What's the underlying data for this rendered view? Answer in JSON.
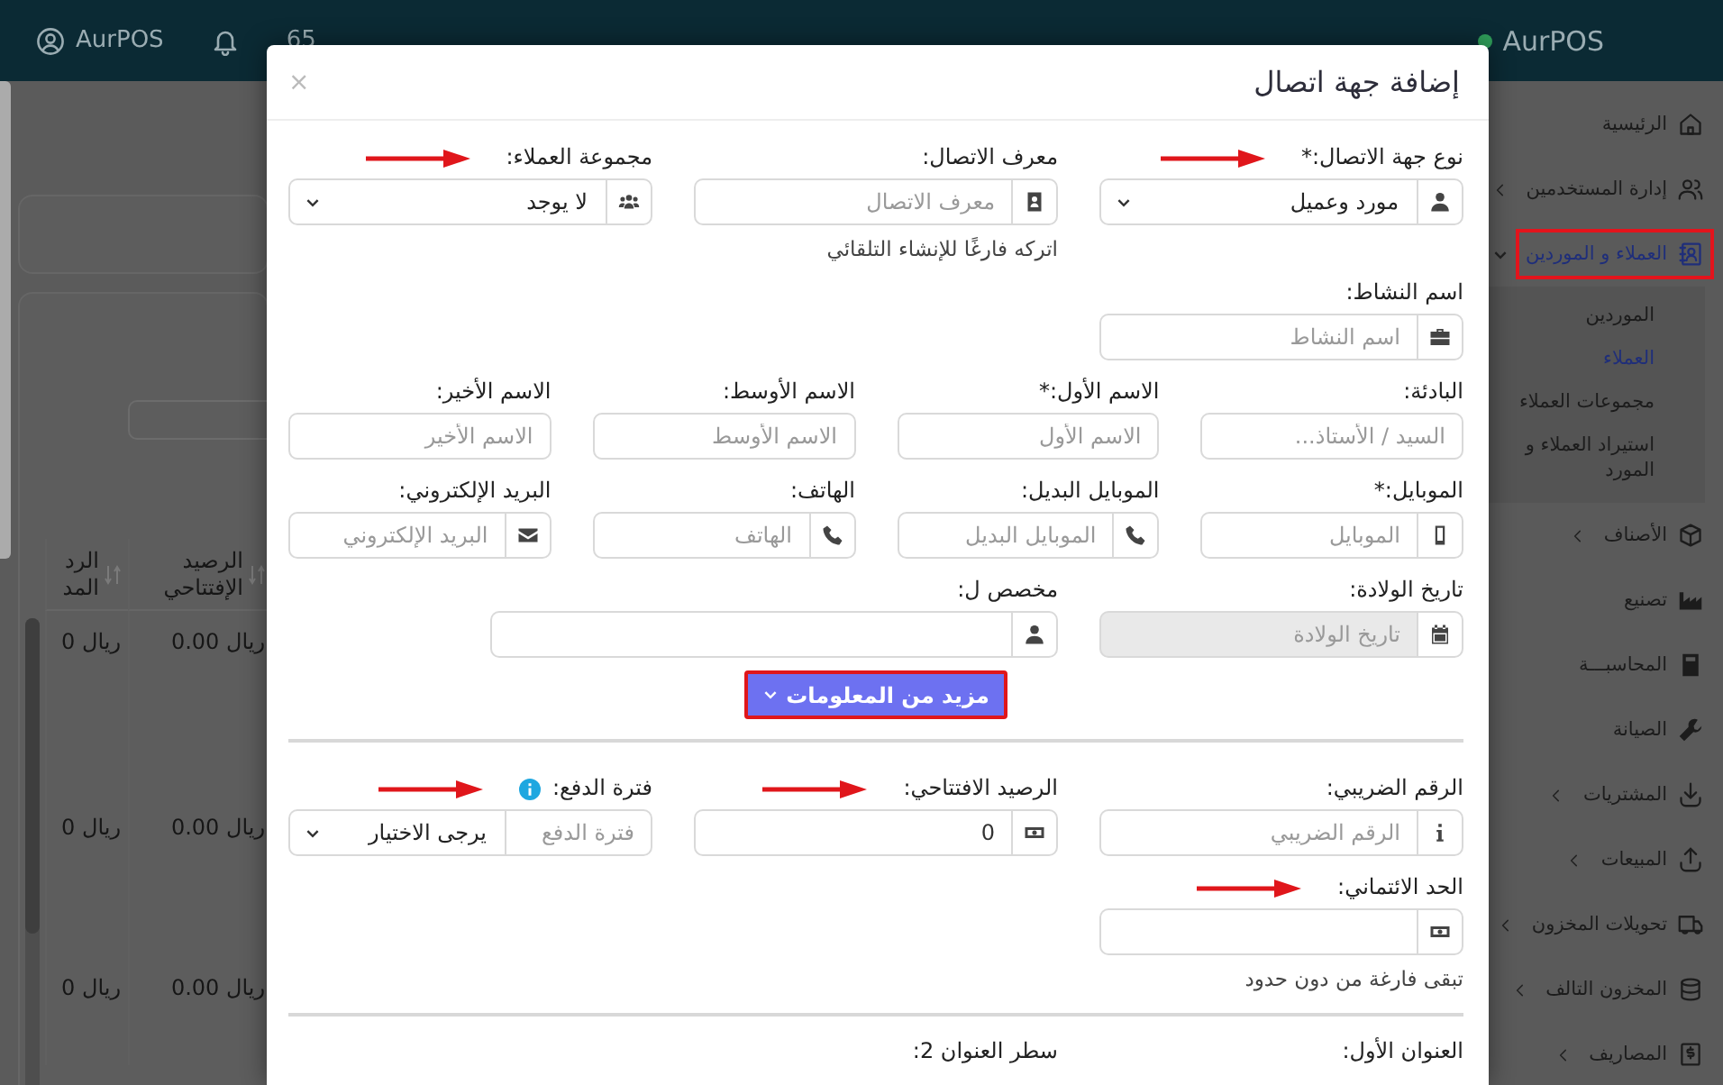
{
  "topbar": {
    "user_label": "AurPOS",
    "counter": "65",
    "brand": "AurPOS"
  },
  "table": {
    "columns": [
      "الرصيد الإفتتاحي",
      "الرد المد"
    ],
    "rows": [
      [
        "ريال 0.00",
        "ريال 0"
      ],
      [
        "ريال 0.00",
        "ريال 0"
      ],
      [
        "ريال 0.00",
        "ريال 0"
      ]
    ]
  },
  "sidebar": {
    "items": [
      {
        "label": "الرئيسية",
        "kind": "link",
        "selected": false,
        "highlighted": false
      },
      {
        "label": "إدارة المستخدمين",
        "kind": "group",
        "expanded": false,
        "selected": false,
        "highlighted": false
      },
      {
        "label": "العملاء و الموردين",
        "kind": "group",
        "expanded": true,
        "selected": true,
        "highlighted": true,
        "children": [
          {
            "label": "الموردين",
            "selected": false
          },
          {
            "label": "العملاء",
            "selected": true
          },
          {
            "label": "مجموعات العملاء",
            "selected": false
          },
          {
            "label": "استيراد العملاء و المورد",
            "selected": false
          }
        ]
      },
      {
        "label": "الأصناف",
        "kind": "group",
        "expanded": false,
        "selected": false,
        "highlighted": false
      },
      {
        "label": "تصنيع",
        "kind": "link",
        "selected": false,
        "highlighted": false
      },
      {
        "label": "المحاسبـــة",
        "kind": "link",
        "selected": false,
        "highlighted": false
      },
      {
        "label": "الصيانة",
        "kind": "link",
        "selected": false,
        "highlighted": false
      },
      {
        "label": "المشتريات",
        "kind": "group",
        "expanded": false,
        "selected": false,
        "highlighted": false
      },
      {
        "label": "المبيعات",
        "kind": "group",
        "expanded": false,
        "selected": false,
        "highlighted": false
      },
      {
        "label": "تحويلات المخزون",
        "kind": "group",
        "expanded": false,
        "selected": false,
        "highlighted": false
      },
      {
        "label": "المخزون التالف",
        "kind": "group",
        "expanded": false,
        "selected": false,
        "highlighted": false
      },
      {
        "label": "المصاريف",
        "kind": "group",
        "expanded": false,
        "selected": false,
        "highlighted": false
      }
    ]
  },
  "modal": {
    "title": "إضافة جهة اتصال",
    "close": "×",
    "main_rows": [
      {
        "fields": [
          {
            "label": "نوع جهة الاتصال:*",
            "kind": "select",
            "value": "مورد وعميل",
            "arrow": true,
            "disabled": false
          },
          {
            "label": "معرف الاتصال:",
            "kind": "input",
            "placeholder": "معرف الاتصال",
            "help": "اتركه فارغًا للإنشاء التلقائي",
            "arrow": false,
            "disabled": false
          },
          {
            "label": "مجموعة العملاء:",
            "kind": "select",
            "value": "لا يوجد",
            "arrow": true,
            "disabled": false
          }
        ]
      },
      {
        "fields": [
          {
            "label": "اسم النشاط:",
            "kind": "input",
            "placeholder": "اسم النشاط",
            "arrow": false,
            "disabled": false
          }
        ]
      },
      {
        "fields": [
          {
            "label": "البادئة:",
            "kind": "input",
            "placeholder": "السيد / الأستاذ...",
            "arrow": false,
            "disabled": false
          },
          {
            "label": "الاسم الأول:*",
            "kind": "input",
            "placeholder": "الاسم الأول",
            "arrow": false,
            "disabled": false
          },
          {
            "label": "الاسم الأوسط:",
            "kind": "input",
            "placeholder": "الاسم الأوسط",
            "arrow": false,
            "disabled": false
          },
          {
            "label": "الاسم الأخير:",
            "kind": "input",
            "placeholder": "الاسم الأخير",
            "arrow": false,
            "disabled": false
          }
        ]
      },
      {
        "fields": [
          {
            "label": "الموبايل:*",
            "kind": "input",
            "placeholder": "الموبايل",
            "arrow": false,
            "disabled": false
          },
          {
            "label": "الموبايل البديل:",
            "kind": "input",
            "placeholder": "الموبايل البديل",
            "arrow": false,
            "disabled": false
          },
          {
            "label": "الهاتف:",
            "kind": "input",
            "placeholder": "الهاتف",
            "arrow": false,
            "disabled": false
          },
          {
            "label": "البريد الإلكتروني:",
            "kind": "input",
            "placeholder": "البريد الإلكتروني",
            "arrow": false,
            "disabled": false
          }
        ]
      },
      {
        "fields": [
          {
            "label": "تاريخ الولادة:",
            "kind": "input",
            "placeholder": "تاريخ الولادة",
            "arrow": false,
            "disabled": true
          },
          {
            "label": "مخصص ل:",
            "kind": "input",
            "arrow": false,
            "disabled": false
          }
        ]
      }
    ],
    "more_button": {
      "label": "مزيد من المعلومات",
      "highlighted": true
    },
    "more_rows": [
      {
        "fields": [
          {
            "label": "الرقم الضريبي:",
            "kind": "input",
            "placeholder": "الرقم الضريبي",
            "arrow": false,
            "disabled": false
          },
          {
            "label": "الرصيد الافتتاحي:",
            "kind": "input",
            "value": "0",
            "arrow": true,
            "disabled": false
          },
          {
            "label": "فترة الدفع:",
            "kind": "input_select",
            "placeholder": "فترة الدفع",
            "value": "يرجى الاختيار",
            "arrow": true,
            "disabled": false
          }
        ]
      },
      {
        "fields": [
          {
            "label": "الحد الائتماني:",
            "kind": "input",
            "help": "تبقى فارغة من دون حدود",
            "arrow": true,
            "disabled": false
          }
        ]
      }
    ],
    "address_rows": [
      {
        "fields": [
          {
            "label": "العنوان الأول:",
            "arrow": false
          },
          {
            "label": "سطر العنوان 2:",
            "arrow": false
          }
        ]
      }
    ]
  }
}
